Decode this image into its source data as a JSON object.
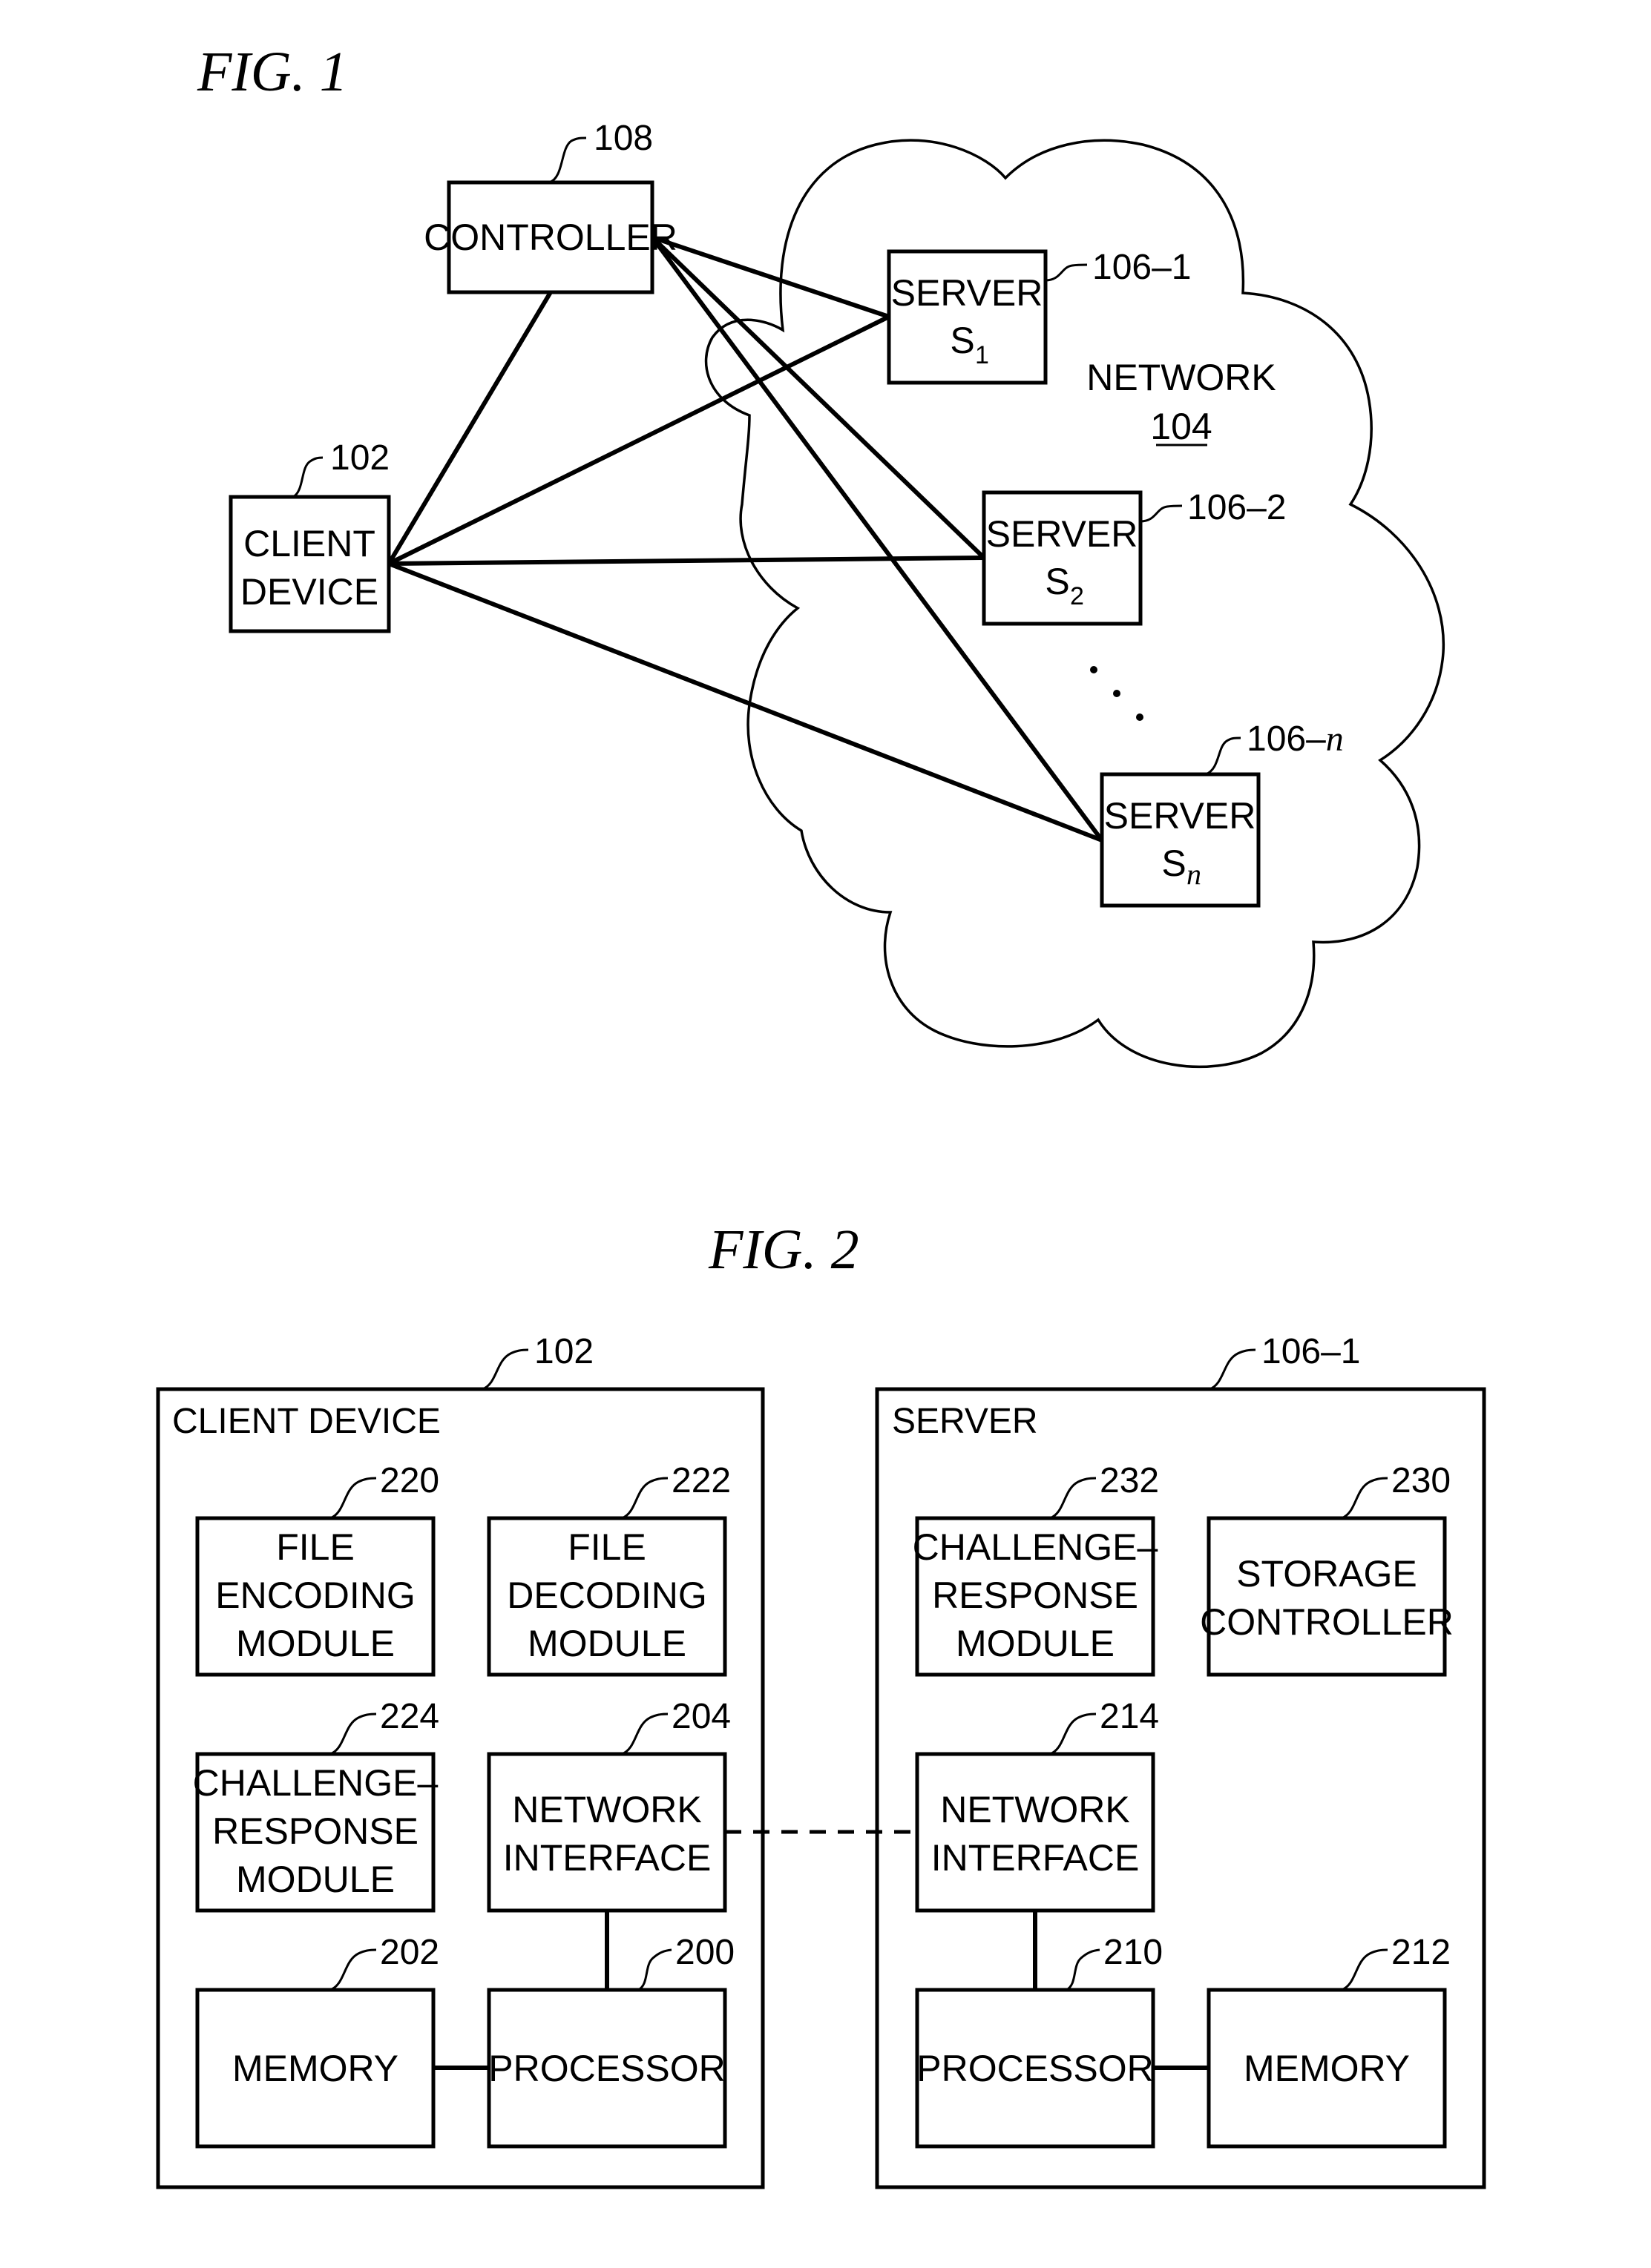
{
  "fig1": {
    "title": "FIG.  1",
    "controller": {
      "label": "CONTROLLER",
      "ref": "108"
    },
    "client_device": {
      "line1": "CLIENT",
      "line2": "DEVICE",
      "ref": "102"
    },
    "network": {
      "label": "NETWORK",
      "ref": "104"
    },
    "servers": [
      {
        "label": "SERVER",
        "symbol": "S",
        "subscript": "1",
        "ref": "106–1"
      },
      {
        "label": "SERVER",
        "symbol": "S",
        "subscript": "2",
        "ref": "106–2"
      },
      {
        "label": "SERVER",
        "symbol": "S",
        "subscript": "n",
        "ref_prefix": "106–",
        "ref_suffix": "n"
      }
    ],
    "ellipsis": "⋱"
  },
  "fig2": {
    "title": "FIG.  2",
    "client": {
      "heading": "CLIENT  DEVICE",
      "ref": "102",
      "modules": [
        {
          "id": "file-encoding",
          "lines": [
            "FILE",
            "ENCODING",
            "MODULE"
          ],
          "ref": "220"
        },
        {
          "id": "file-decoding",
          "lines": [
            "FILE",
            "DECODING",
            "MODULE"
          ],
          "ref": "222"
        },
        {
          "id": "challenge-response",
          "lines": [
            "CHALLENGE–",
            "RESPONSE",
            "MODULE"
          ],
          "ref": "224"
        },
        {
          "id": "network-interface",
          "lines": [
            "NETWORK",
            "INTERFACE"
          ],
          "ref": "204"
        },
        {
          "id": "memory",
          "lines": [
            "MEMORY"
          ],
          "ref": "202"
        },
        {
          "id": "processor",
          "lines": [
            "PROCESSOR"
          ],
          "ref": "200"
        }
      ]
    },
    "server": {
      "heading": "SERVER",
      "ref": "106–1",
      "modules": [
        {
          "id": "challenge-response",
          "lines": [
            "CHALLENGE–",
            "RESPONSE",
            "MODULE"
          ],
          "ref": "232"
        },
        {
          "id": "storage-controller",
          "lines": [
            "STORAGE",
            "CONTROLLER"
          ],
          "ref": "230"
        },
        {
          "id": "network-interface",
          "lines": [
            "NETWORK",
            "INTERFACE"
          ],
          "ref": "214"
        },
        {
          "id": "processor",
          "lines": [
            "PROCESSOR"
          ],
          "ref": "210"
        },
        {
          "id": "memory",
          "lines": [
            "MEMORY"
          ],
          "ref": "212"
        }
      ]
    }
  }
}
